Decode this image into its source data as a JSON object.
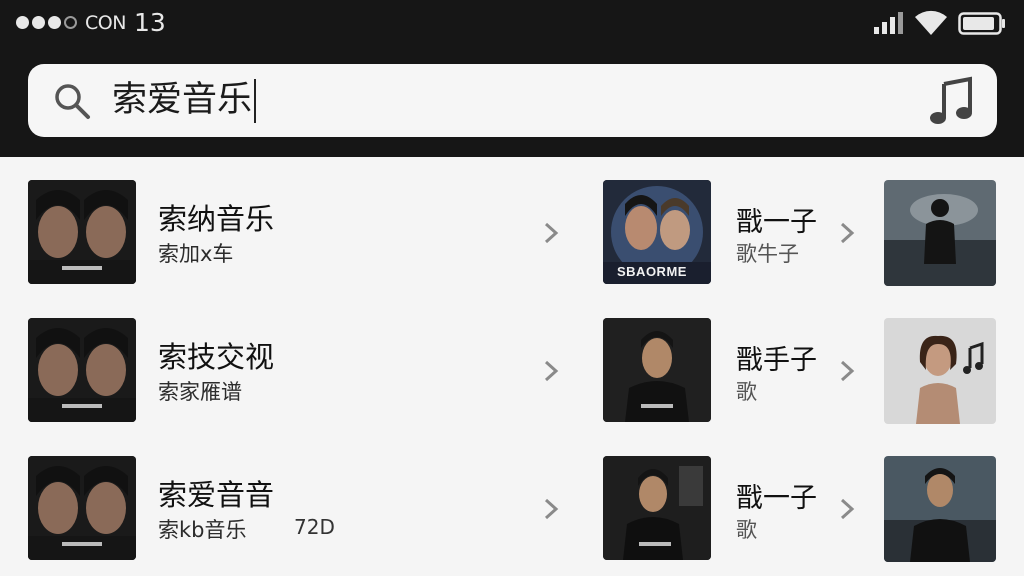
{
  "status_bar": {
    "carrier": "CON",
    "time": "13",
    "signal_icon": "signal-bars-icon",
    "wifi_icon": "wifi-icon",
    "battery_icon": "battery-icon"
  },
  "search": {
    "query": "索爱音乐",
    "search_icon": "magnifier-icon",
    "music_icon": "music-note-icon"
  },
  "left_results": [
    {
      "title": "索纳音乐",
      "subtitle": "索加x车",
      "extra": ""
    },
    {
      "title": "索技交视",
      "subtitle": "索家雁谱",
      "extra": ""
    },
    {
      "title": "索爱音音",
      "subtitle": "索kb音乐",
      "extra": "72D"
    }
  ],
  "right_results": [
    {
      "title": "戬一子",
      "subtitle": "歌牛子",
      "cover_text": "SBAORME"
    },
    {
      "title": "戬手子",
      "subtitle": "歌",
      "cover_text": ""
    },
    {
      "title": "戬一子",
      "subtitle": "歌",
      "cover_text": ""
    }
  ],
  "colors": {
    "header_bg": "#161616",
    "page_bg": "#f5f5f5",
    "search_bg": "#f6f6f6",
    "chevron": "#8a8a8a"
  }
}
